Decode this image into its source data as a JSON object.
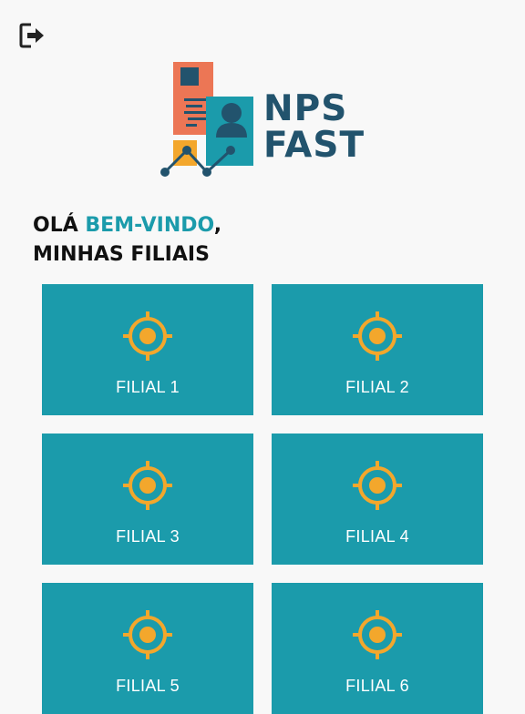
{
  "header": {
    "logout_icon": "logout-icon"
  },
  "logo": {
    "line1": "NPS",
    "line2": "FAST"
  },
  "greeting": {
    "prefix": "OLÁ ",
    "highlight": "BEM-VINDO",
    "suffix": ",",
    "line2": "MINHAS FILIAIS"
  },
  "colors": {
    "accent": "#1b9bab",
    "brand": "#22536d",
    "target": "#f3a72c",
    "logo_orange": "#ec7655"
  },
  "branches": [
    {
      "label": "FILIAL 1",
      "icon": "target-icon"
    },
    {
      "label": "FILIAL 2",
      "icon": "target-icon"
    },
    {
      "label": "FILIAL 3",
      "icon": "target-icon"
    },
    {
      "label": "FILIAL 4",
      "icon": "target-icon"
    },
    {
      "label": "FILIAL 5",
      "icon": "target-icon"
    },
    {
      "label": "FILIAL 6",
      "icon": "target-icon"
    }
  ]
}
